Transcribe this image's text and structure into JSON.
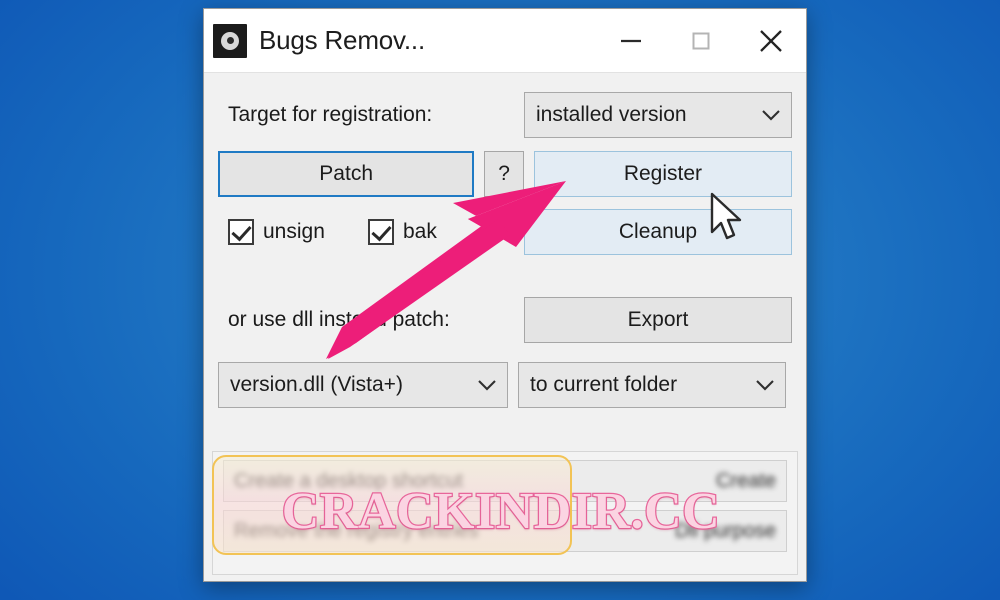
{
  "desktop": {
    "background_color_outer": "#0a4aa8",
    "background_color_inner": "#2b86cd"
  },
  "window": {
    "title": "Bugs Remov...",
    "icon_name": "app-icon",
    "caption": {
      "minimize_label": "—",
      "maximize_label": "□",
      "close_label": "✕"
    }
  },
  "form": {
    "target_label": "Target for registration:",
    "target_combo": {
      "value": "installed version",
      "chevron": "∨"
    },
    "patch_button": "Patch",
    "help_button": "?",
    "register_button": "Register",
    "cleanup_button": "Cleanup",
    "checkboxes": [
      {
        "label": "unsign",
        "checked": true
      },
      {
        "label": "bak",
        "checked": true
      }
    ],
    "dll_label": "or use dll instead patch:",
    "export_button": "Export",
    "dll_combo": {
      "value": "version.dll (Vista+)",
      "chevron": "∨"
    },
    "folder_combo": {
      "value": "to current folder",
      "chevron": "∨"
    }
  },
  "bottom_panel": {
    "rows": [
      {
        "left": "Create a desktop shortcut",
        "right": "Create"
      },
      {
        "left": "Remove the registry entries",
        "right": "Dll purpose"
      }
    ]
  },
  "watermark": {
    "text": "CRACKINDIR.CC",
    "fill_color": "#fbd4e2",
    "stroke_color": "#e8669b",
    "frame_color": "#f2c355"
  },
  "annotation": {
    "arrow_color": "#ed1e79",
    "arrow_target": "register-button",
    "cursor_name": "mouse-pointer"
  }
}
